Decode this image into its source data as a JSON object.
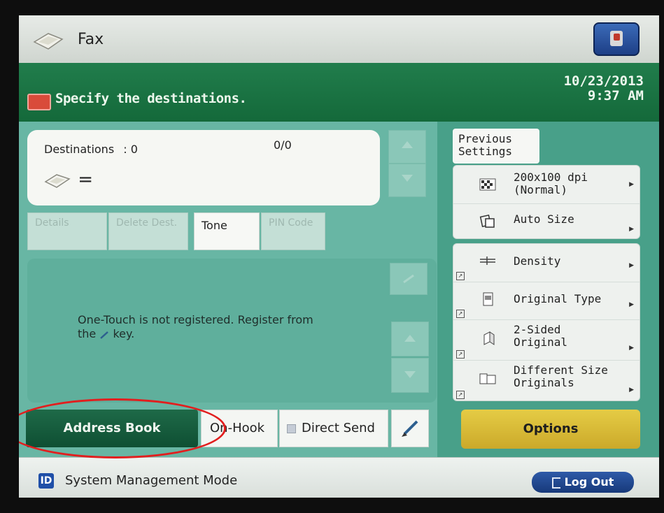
{
  "app": {
    "title": "Fax"
  },
  "status": {
    "message": "Specify the destinations.",
    "date": "10/23/2013",
    "time": "9:37 AM"
  },
  "destinations": {
    "label": "Destinations",
    "count_sep": ":",
    "count": "0",
    "page_count": "0/0",
    "equals": "="
  },
  "dest_buttons": {
    "details": "Details",
    "delete_dest": "Delete Dest.",
    "tone": "Tone",
    "pin_code": "PIN Code"
  },
  "onetouch": {
    "message_line1": "One-Touch is not registered. Register from",
    "message_line2_pre": "the",
    "message_line2_post": "key."
  },
  "bottom": {
    "address_book": "Address Book",
    "on_hook": "On-Hook",
    "direct_send": "Direct Send"
  },
  "settings": {
    "previous_settings_line1": "Previous",
    "previous_settings_line2": "Settings",
    "resolution_line1": "200x100 dpi",
    "resolution_line2": "(Normal)",
    "auto_size": "Auto Size",
    "density": "Density",
    "original_type": "Original Type",
    "two_sided_line1": "2-Sided",
    "two_sided_line2": "Original",
    "diff_size_line1": "Different Size",
    "diff_size_line2": "Originals",
    "options": "Options"
  },
  "footer": {
    "id_icon": "ID",
    "mode": "System Management Mode",
    "logout": "Log Out"
  },
  "colors": {
    "accent_green": "#217d4c",
    "panel_teal": "#68b6a4",
    "options_yellow": "#e5cc45",
    "logout_blue": "#2e5aa8",
    "highlight_red": "#e21e1e"
  }
}
